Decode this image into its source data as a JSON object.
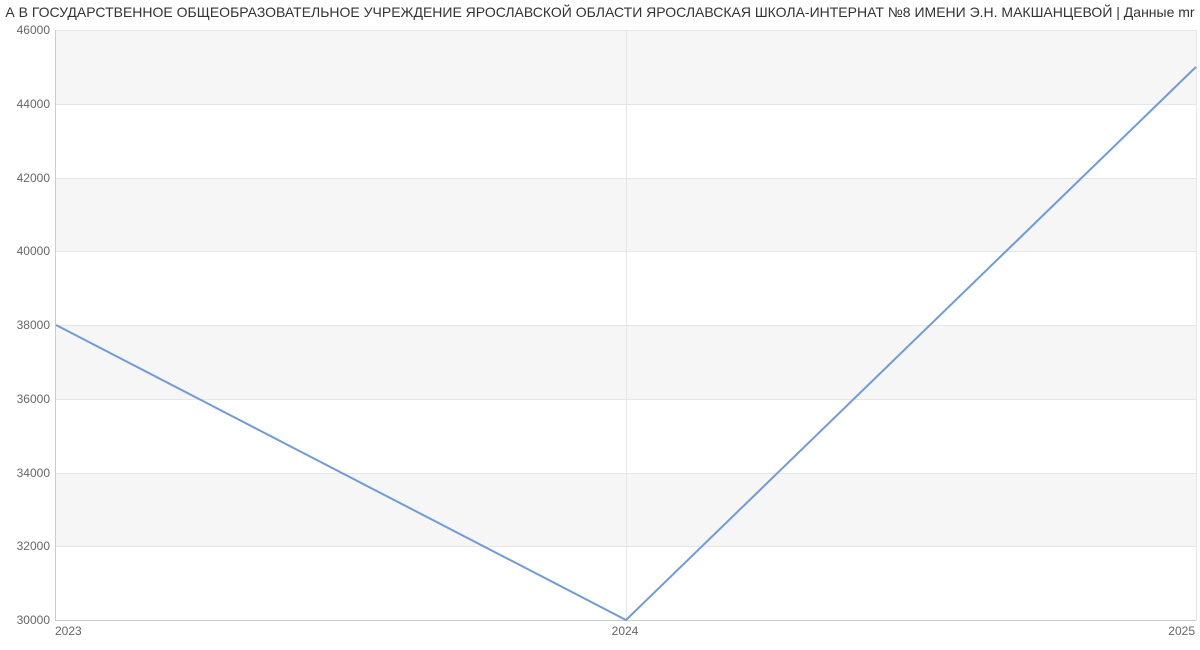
{
  "chart_data": {
    "type": "line",
    "title": "А В ГОСУДАРСТВЕННОЕ ОБЩЕОБРАЗОВАТЕЛЬНОЕ УЧРЕЖДЕНИЕ ЯРОСЛАВСКОЙ ОБЛАСТИ ЯРОСЛАВСКАЯ ШКОЛА-ИНТЕРНАТ №8 ИМЕНИ Э.Н. МАКШАНЦЕВОЙ | Данные mr",
    "categories": [
      "2023",
      "2024",
      "2025"
    ],
    "x": [
      2023,
      2024,
      2025
    ],
    "values": [
      38000,
      30000,
      45000
    ],
    "xlabel": "",
    "ylabel": "",
    "ylim": [
      30000,
      46000
    ],
    "yticks": [
      30000,
      32000,
      34000,
      36000,
      38000,
      40000,
      42000,
      44000,
      46000
    ],
    "xticks": [
      2023,
      2024,
      2025
    ],
    "line_color": "#6f9cd9",
    "grid": true
  },
  "ylabels": {
    "t30000": "30000",
    "t32000": "32000",
    "t34000": "34000",
    "t36000": "36000",
    "t38000": "38000",
    "t40000": "40000",
    "t42000": "42000",
    "t44000": "44000",
    "t46000": "46000"
  },
  "xlabels": {
    "x2023": "2023",
    "x2024": "2024",
    "x2025": "2025"
  }
}
